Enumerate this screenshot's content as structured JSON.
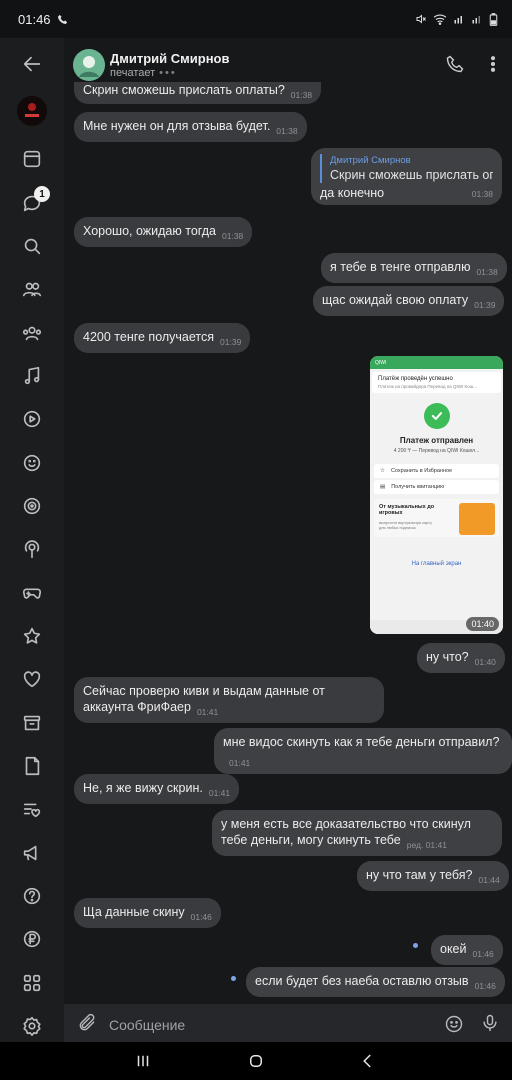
{
  "status_bar": {
    "time": "01:46"
  },
  "sidebar": {
    "badge_count": "1"
  },
  "header": {
    "name": "Дмитрий Смирнов",
    "status": "печатает"
  },
  "messages": [
    {
      "dir": "in",
      "text": "Скрин сможешь прислать оплаты?",
      "time": "01:38"
    },
    {
      "dir": "in",
      "text": "Мне нужен он для отзыва будет.",
      "time": "01:38"
    },
    {
      "dir": "out",
      "reply_name": "Дмитрий Смирнов",
      "reply_text": "Скрин сможешь прислать оп...",
      "text": "да конечно",
      "time": "01:38"
    },
    {
      "dir": "in",
      "text": "Хорошо, ожидаю тогда",
      "time": "01:38"
    },
    {
      "dir": "out",
      "text": "я тебе в тенге отправлю",
      "time": "01:38"
    },
    {
      "dir": "out",
      "text": "щас ожидай свою оплату",
      "time": "01:39"
    },
    {
      "dir": "in",
      "text": "4200 тенге получается",
      "time": "01:39"
    },
    {
      "dir": "out",
      "type": "image",
      "time": "01:40"
    },
    {
      "dir": "out",
      "text": "ну что?",
      "time": "01:40"
    },
    {
      "dir": "in",
      "text": "Сейчас проверю киви и выдам данные от аккаунта ФриФаер",
      "time": "01:41"
    },
    {
      "dir": "out",
      "text": "мне видос скинуть как я тебе деньги отправил?",
      "time": "01:41"
    },
    {
      "dir": "in",
      "text": "Не, я же вижу скрин.",
      "time": "01:41"
    },
    {
      "dir": "out",
      "text": "у меня есть все доказательство что скинул тебе деньги, могу скинуть тебе",
      "time": "ред. 01:41"
    },
    {
      "dir": "out",
      "text": "ну что там у тебя?",
      "time": "01:44"
    },
    {
      "dir": "in",
      "text": "Ща данные скину",
      "time": "01:46"
    },
    {
      "dir": "out",
      "text": "окей",
      "time": "01:46"
    },
    {
      "dir": "out",
      "text": "если будет без наеба оставлю отзыв",
      "time": "01:46"
    }
  ],
  "screenshot": {
    "top_bar": "QIWI",
    "title": "Платёж проведён успешно",
    "subtitle": "Платеж на провайдера Перевод на QIWI Кош...",
    "heading": "Платеж отправлен",
    "amount": "4 200 ₸ — Перевод на QIWI Кошел...",
    "option1": "Сохранить в Избранное",
    "option2": "Получить квитанцию",
    "promo_title": "От музыкальных до игровых",
    "promo_sub": "выпустите виртуальную карту для любых подписок",
    "link": "На главный экран"
  },
  "composer": {
    "placeholder": "Сообщение"
  }
}
